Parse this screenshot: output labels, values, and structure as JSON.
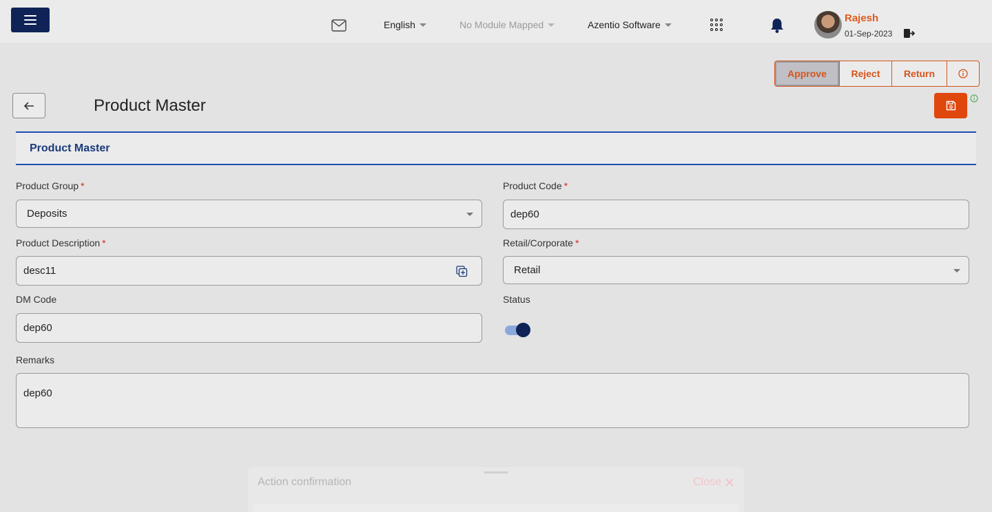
{
  "header": {
    "language": "English",
    "module": "No Module Mapped",
    "company": "Azentio Software",
    "user_name": "Rajesh",
    "user_date": "01-Sep-2023"
  },
  "actions": {
    "approve": "Approve",
    "reject": "Reject",
    "return": "Return"
  },
  "page": {
    "title": "Product Master",
    "section_title": "Product Master"
  },
  "form": {
    "product_group": {
      "label": "Product Group",
      "required": "*",
      "value": "Deposits"
    },
    "product_code": {
      "label": "Product Code",
      "required": "*",
      "value": "dep60"
    },
    "product_description": {
      "label": "Product Description",
      "required": "*",
      "value": "desc11"
    },
    "retail_corporate": {
      "label": "Retail/Corporate",
      "required": "*",
      "value": "Retail"
    },
    "dm_code": {
      "label": "DM Code",
      "value": "dep60"
    },
    "status": {
      "label": "Status"
    },
    "remarks": {
      "label": "Remarks",
      "value": "dep60"
    }
  },
  "dialog": {
    "title": "Action confirmation",
    "close": "Close"
  },
  "colors": {
    "accent_orange": "#e0470c",
    "navy": "#0f2357",
    "section_blue": "#1d4fb0"
  }
}
